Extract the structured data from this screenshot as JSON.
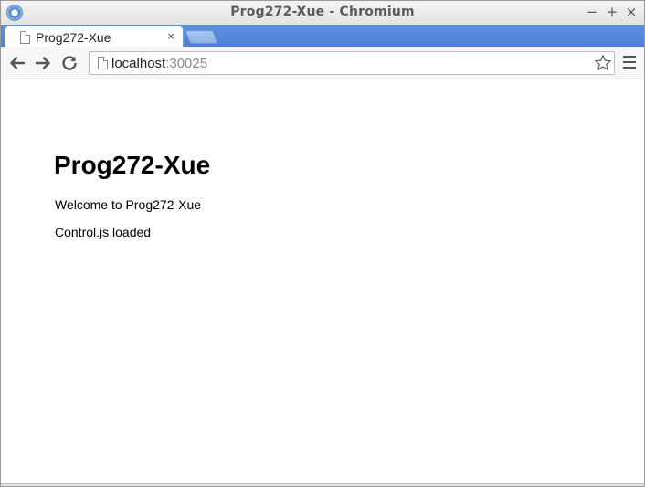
{
  "window": {
    "title": "Prog272-Xue - Chromium",
    "minimize_glyph": "−",
    "maximize_glyph": "+",
    "close_glyph": "×"
  },
  "tabs": [
    {
      "label": "Prog272-Xue",
      "close_glyph": "×",
      "active": true
    }
  ],
  "toolbar": {
    "url_host": "localhost",
    "url_port": ":30025",
    "icons": [
      "back-arrow-icon",
      "forward-arrow-icon",
      "reload-icon",
      "page-icon",
      "bookmark-star-icon",
      "menu-icon"
    ]
  },
  "page": {
    "heading": "Prog272-Xue",
    "paragraphs": [
      "Welcome to Prog272-Xue",
      "Control.js loaded"
    ]
  },
  "colors": {
    "tabstrip": "#4d80d2",
    "title_text": "#5a5a5a"
  }
}
